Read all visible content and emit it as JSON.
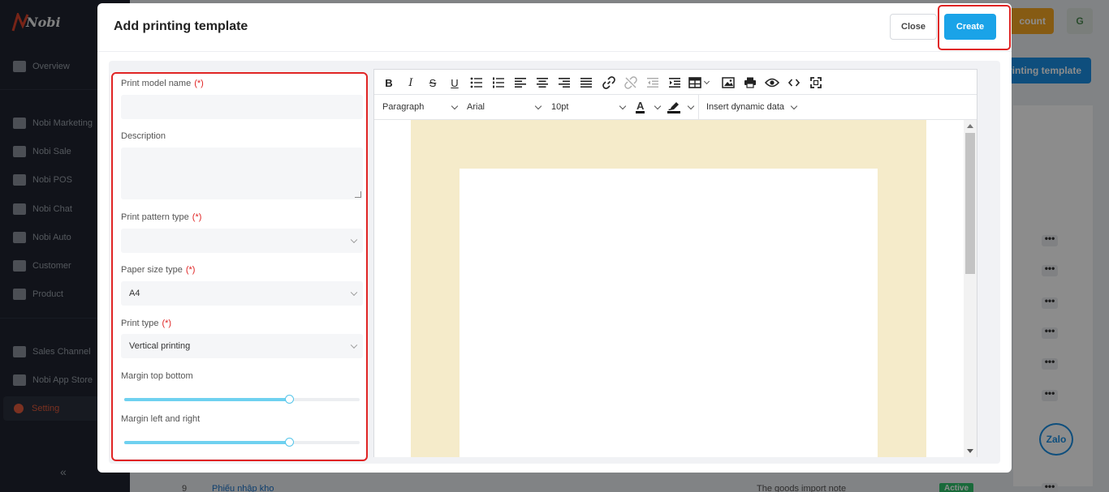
{
  "app": {
    "logo_text": "Nobi",
    "sidebar": {
      "items": [
        {
          "label": "Overview",
          "icon": "layers-icon"
        },
        {
          "label": "Nobi Marketing",
          "icon": "marketing-icon"
        },
        {
          "label": "Nobi Sale",
          "icon": "phone-icon"
        },
        {
          "label": "Nobi POS",
          "icon": "pos-icon"
        },
        {
          "label": "Nobi Chat",
          "icon": "chat-icon"
        },
        {
          "label": "Nobi Auto",
          "icon": "auto-icon"
        },
        {
          "label": "Customer",
          "icon": "users-icon"
        },
        {
          "label": "Product",
          "icon": "product-icon"
        },
        {
          "label": "Sales Channel",
          "icon": "store-icon"
        },
        {
          "label": "Nobi App Store",
          "icon": "apps-icon"
        },
        {
          "label": "Setting",
          "icon": "gear-icon"
        }
      ],
      "active": "Setting",
      "collapse_glyph": "«"
    },
    "topbar": {
      "account_button_partial": "count",
      "avatar_letter": "G"
    },
    "add_button_partial": "rinting template",
    "row_action": "•••",
    "bottom_row": {
      "index": "9",
      "name": "Phiếu nhập kho",
      "type": "The goods import note",
      "status": "Active"
    },
    "zalo_label": "Zalo",
    "accent_color": "#1aa3e8",
    "active_color": "#e15a3c"
  },
  "modal": {
    "title": "Add printing template",
    "close_label": "Close",
    "create_label": "Create",
    "form": {
      "required_mark": "(*)",
      "print_model_name": {
        "label": "Print model name",
        "value": ""
      },
      "description": {
        "label": "Description",
        "value": ""
      },
      "print_pattern_type": {
        "label": "Print pattern type",
        "value": ""
      },
      "paper_size_type": {
        "label": "Paper size type",
        "value": "A4"
      },
      "print_type": {
        "label": "Print type",
        "value": "Vertical printing"
      },
      "margin_top_bottom": {
        "label": "Margin top bottom",
        "level": 0.7
      },
      "margin_left_right": {
        "label": "Margin left and right",
        "level": 0.7
      }
    },
    "editor": {
      "block_format": "Paragraph",
      "font_family": "Arial",
      "font_size": "10pt",
      "text_color_glyph": "A",
      "dynamic_data_label": "Insert dynamic data",
      "page_margin_color": "#f5ebca"
    }
  }
}
